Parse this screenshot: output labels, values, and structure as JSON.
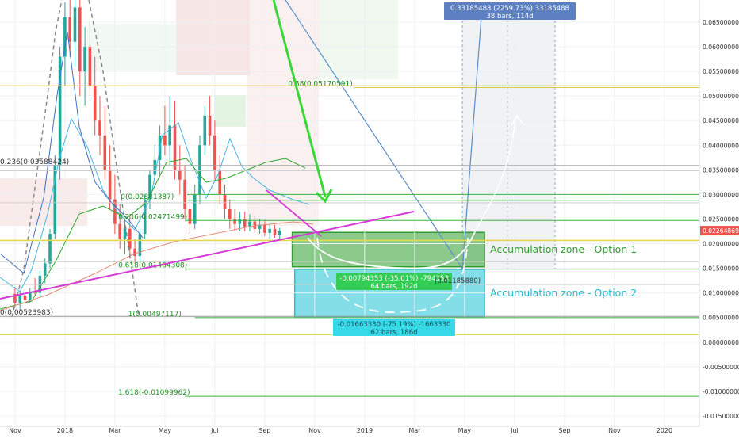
{
  "chart_data": {
    "type": "candlestick",
    "price_scale": {
      "ticks": [
        "0.06500000",
        "0.06000000",
        "0.05500000",
        "0.05000000",
        "0.04500000",
        "0.04000000",
        "0.03500000",
        "0.03000000",
        "0.02500000",
        "0.02000000",
        "0.01500000",
        "0.01000000",
        "0.00500000",
        "0.00000000",
        "-0.00500000",
        "-0.01000000",
        "-0.01500000"
      ],
      "tick_values": [
        0.065,
        0.06,
        0.055,
        0.05,
        0.045,
        0.04,
        0.035,
        0.03,
        0.025,
        0.02,
        0.015,
        0.01,
        0.005,
        0.0,
        -0.005,
        -0.01,
        -0.015
      ],
      "ylim": [
        -0.0171,
        0.0695
      ],
      "current_price_label": "0.02264869",
      "current_price": 0.02265
    },
    "time_scale": {
      "labels": [
        "Nov",
        "2018",
        "Mar",
        "May",
        "Jul",
        "Sep",
        "Nov",
        "2019",
        "Mar",
        "May",
        "Jul",
        "Sep",
        "Nov",
        "2020"
      ],
      "label_months": [
        0,
        2,
        4,
        6,
        8,
        10,
        12,
        14,
        16,
        18,
        20,
        22,
        24,
        26
      ],
      "xlim": [
        -0.6,
        27.4
      ]
    },
    "fib_levels": [
      {
        "label": "0.88(0.05170591)",
        "value": 0.05171,
        "from_month": 13.6
      },
      {
        "label": "0.236(0.03588424)",
        "value": 0.03588,
        "from_month": -0.6
      },
      {
        "label": "0(0.02881387)",
        "value": 0.02881,
        "from_month": 6.9
      },
      {
        "label": "0.236(0.02471499)",
        "value": 0.02471,
        "from_month": 6.8
      },
      {
        "label": "0.618(0.01484308)",
        "value": 0.01484,
        "from_month": 6.8
      },
      {
        "label": "0(0.00523983)",
        "value": 0.00524,
        "from_month": -0.6
      },
      {
        "label": "1(0.00497117)",
        "value": 0.00497,
        "from_month": 7.2
      },
      {
        "label": "1.618(-0.01099962)",
        "value": -0.011,
        "from_month": 6.8
      }
    ],
    "zones": [
      {
        "label": "Accumulation zone - Option 1",
        "top": 0.0223,
        "bottom": 0.0153,
        "from_month": 11.1,
        "to_month": 18.8,
        "color": "#2e9e2e"
      },
      {
        "label": "Accumulation zone - Option 2",
        "top": 0.0148,
        "bottom": 0.0051,
        "from_month": 11.2,
        "to_month": 18.8,
        "color": "#1fc3d6"
      }
    ],
    "measure_boxes": [
      {
        "line1": "0.33185488 (2259.73%) 33185488",
        "line2": "38 bars, 114d"
      },
      {
        "line1": "-0.00794353 (-35.01%) -794353",
        "line2": "64 bars, 192d"
      },
      {
        "line1": "-0.01663330 (-75.19%) -1663330",
        "line2": "62 bars, 186d"
      },
      {
        "line1": "(0.01185880)"
      }
    ],
    "candles": [
      {
        "m": 0.0,
        "o": 0.0098,
        "h": 0.0112,
        "l": 0.007,
        "c": 0.008
      },
      {
        "m": 0.2,
        "o": 0.008,
        "h": 0.0105,
        "l": 0.0062,
        "c": 0.0095
      },
      {
        "m": 0.4,
        "o": 0.0095,
        "h": 0.0108,
        "l": 0.0078,
        "c": 0.0085
      },
      {
        "m": 0.6,
        "o": 0.0085,
        "h": 0.011,
        "l": 0.008,
        "c": 0.0102
      },
      {
        "m": 0.8,
        "o": 0.0102,
        "h": 0.013,
        "l": 0.0095,
        "c": 0.01
      },
      {
        "m": 1.0,
        "o": 0.01,
        "h": 0.0145,
        "l": 0.0092,
        "c": 0.0135
      },
      {
        "m": 1.2,
        "o": 0.0135,
        "h": 0.017,
        "l": 0.012,
        "c": 0.016
      },
      {
        "m": 1.4,
        "o": 0.016,
        "h": 0.023,
        "l": 0.015,
        "c": 0.022
      },
      {
        "m": 1.6,
        "o": 0.022,
        "h": 0.038,
        "l": 0.021,
        "c": 0.036
      },
      {
        "m": 1.8,
        "o": 0.036,
        "h": 0.06,
        "l": 0.033,
        "c": 0.058
      },
      {
        "m": 2.0,
        "o": 0.058,
        "h": 0.069,
        "l": 0.052,
        "c": 0.066
      },
      {
        "m": 2.2,
        "o": 0.066,
        "h": 0.0695,
        "l": 0.058,
        "c": 0.061
      },
      {
        "m": 2.4,
        "o": 0.061,
        "h": 0.0695,
        "l": 0.056,
        "c": 0.068
      },
      {
        "m": 2.6,
        "o": 0.068,
        "h": 0.0695,
        "l": 0.05,
        "c": 0.055
      },
      {
        "m": 2.8,
        "o": 0.055,
        "h": 0.064,
        "l": 0.048,
        "c": 0.06
      },
      {
        "m": 3.0,
        "o": 0.06,
        "h": 0.066,
        "l": 0.05,
        "c": 0.052
      },
      {
        "m": 3.2,
        "o": 0.052,
        "h": 0.058,
        "l": 0.042,
        "c": 0.045
      },
      {
        "m": 3.4,
        "o": 0.045,
        "h": 0.05,
        "l": 0.038,
        "c": 0.042
      },
      {
        "m": 3.6,
        "o": 0.042,
        "h": 0.048,
        "l": 0.033,
        "c": 0.035
      },
      {
        "m": 3.8,
        "o": 0.035,
        "h": 0.04,
        "l": 0.027,
        "c": 0.029
      },
      {
        "m": 4.0,
        "o": 0.029,
        "h": 0.034,
        "l": 0.022,
        "c": 0.024
      },
      {
        "m": 4.2,
        "o": 0.024,
        "h": 0.028,
        "l": 0.019,
        "c": 0.021
      },
      {
        "m": 4.4,
        "o": 0.021,
        "h": 0.025,
        "l": 0.018,
        "c": 0.023
      },
      {
        "m": 4.6,
        "o": 0.023,
        "h": 0.026,
        "l": 0.017,
        "c": 0.019
      },
      {
        "m": 4.8,
        "o": 0.019,
        "h": 0.021,
        "l": 0.016,
        "c": 0.0175
      },
      {
        "m": 5.0,
        "o": 0.0175,
        "h": 0.023,
        "l": 0.0165,
        "c": 0.022
      },
      {
        "m": 5.2,
        "o": 0.022,
        "h": 0.03,
        "l": 0.021,
        "c": 0.029
      },
      {
        "m": 5.4,
        "o": 0.029,
        "h": 0.035,
        "l": 0.027,
        "c": 0.034
      },
      {
        "m": 5.6,
        "o": 0.034,
        "h": 0.04,
        "l": 0.032,
        "c": 0.037
      },
      {
        "m": 5.8,
        "o": 0.037,
        "h": 0.044,
        "l": 0.034,
        "c": 0.042
      },
      {
        "m": 6.0,
        "o": 0.042,
        "h": 0.048,
        "l": 0.038,
        "c": 0.04
      },
      {
        "m": 6.2,
        "o": 0.04,
        "h": 0.05,
        "l": 0.036,
        "c": 0.044
      },
      {
        "m": 6.4,
        "o": 0.044,
        "h": 0.049,
        "l": 0.033,
        "c": 0.035
      },
      {
        "m": 6.6,
        "o": 0.035,
        "h": 0.04,
        "l": 0.03,
        "c": 0.033
      },
      {
        "m": 6.8,
        "o": 0.033,
        "h": 0.036,
        "l": 0.025,
        "c": 0.027
      },
      {
        "m": 7.0,
        "o": 0.027,
        "h": 0.03,
        "l": 0.022,
        "c": 0.024
      },
      {
        "m": 7.2,
        "o": 0.024,
        "h": 0.032,
        "l": 0.023,
        "c": 0.03
      },
      {
        "m": 7.4,
        "o": 0.03,
        "h": 0.042,
        "l": 0.028,
        "c": 0.04
      },
      {
        "m": 7.6,
        "o": 0.04,
        "h": 0.048,
        "l": 0.038,
        "c": 0.046
      },
      {
        "m": 7.8,
        "o": 0.046,
        "h": 0.05,
        "l": 0.04,
        "c": 0.042
      },
      {
        "m": 8.0,
        "o": 0.042,
        "h": 0.045,
        "l": 0.033,
        "c": 0.035
      },
      {
        "m": 8.2,
        "o": 0.035,
        "h": 0.038,
        "l": 0.028,
        "c": 0.03
      },
      {
        "m": 8.4,
        "o": 0.03,
        "h": 0.032,
        "l": 0.025,
        "c": 0.027
      },
      {
        "m": 8.6,
        "o": 0.027,
        "h": 0.029,
        "l": 0.023,
        "c": 0.025
      },
      {
        "m": 8.8,
        "o": 0.025,
        "h": 0.027,
        "l": 0.0225,
        "c": 0.024
      },
      {
        "m": 9.0,
        "o": 0.024,
        "h": 0.0265,
        "l": 0.0225,
        "c": 0.025
      },
      {
        "m": 9.2,
        "o": 0.025,
        "h": 0.0265,
        "l": 0.0225,
        "c": 0.0235
      },
      {
        "m": 9.4,
        "o": 0.0235,
        "h": 0.026,
        "l": 0.0225,
        "c": 0.0245
      },
      {
        "m": 9.6,
        "o": 0.0245,
        "h": 0.0255,
        "l": 0.0222,
        "c": 0.023
      },
      {
        "m": 9.8,
        "o": 0.023,
        "h": 0.025,
        "l": 0.022,
        "c": 0.0238
      },
      {
        "m": 10.0,
        "o": 0.0238,
        "h": 0.0248,
        "l": 0.0215,
        "c": 0.0222
      },
      {
        "m": 10.2,
        "o": 0.0222,
        "h": 0.024,
        "l": 0.021,
        "c": 0.023
      },
      {
        "m": 10.4,
        "o": 0.023,
        "h": 0.0238,
        "l": 0.0212,
        "c": 0.0218
      },
      {
        "m": 10.6,
        "o": 0.0218,
        "h": 0.0232,
        "l": 0.0208,
        "c": 0.0226
      }
    ]
  }
}
